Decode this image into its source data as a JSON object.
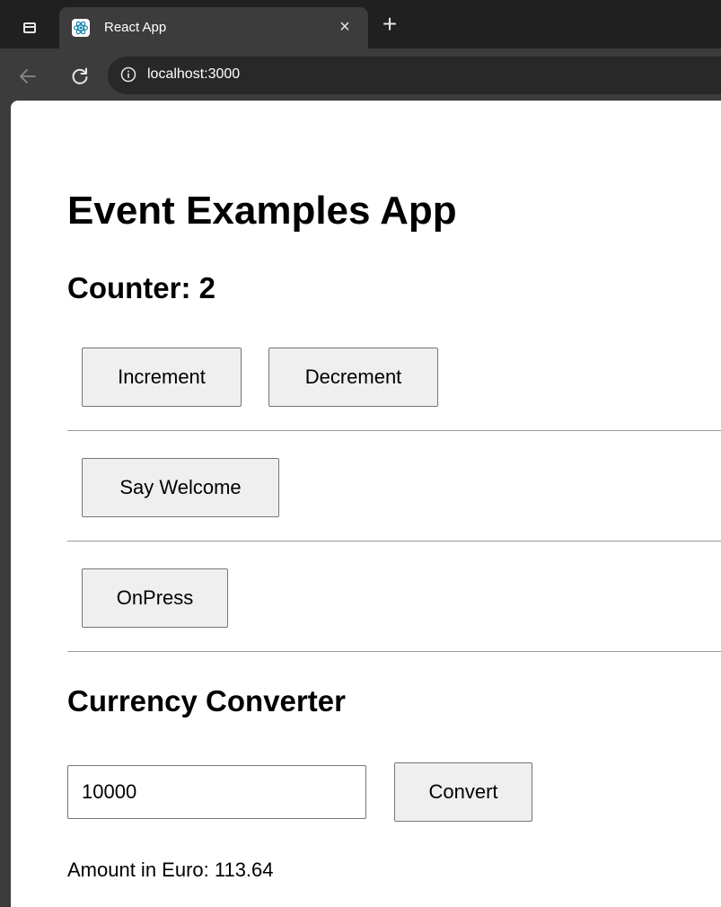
{
  "browser": {
    "tab_title": "React App",
    "tab_close": "×",
    "new_tab": "+",
    "url": "localhost:3000",
    "accent_color": "#61dafb"
  },
  "page": {
    "title": "Event Examples App",
    "counter_heading": "Counter: 2",
    "increment_label": "Increment",
    "decrement_label": "Decrement",
    "welcome_label": "Say Welcome",
    "onpress_label": "OnPress",
    "currency_heading": "Currency Converter",
    "amount_value": "10000",
    "convert_label": "Convert",
    "result_text": "Amount in Euro: 113.64"
  }
}
